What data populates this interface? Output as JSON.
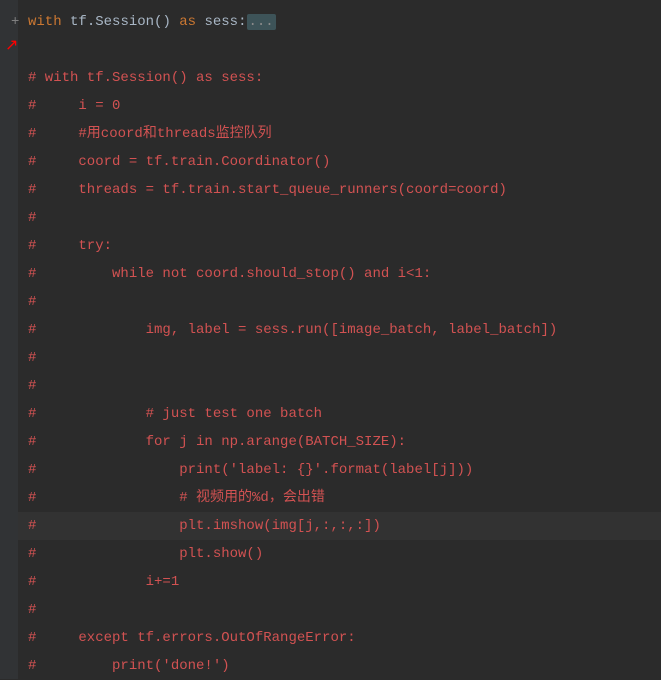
{
  "gutter": {
    "plus": "+"
  },
  "line1": {
    "with": "with",
    "tf": " tf",
    "dot": ".",
    "session": "Session",
    "paren": "()",
    "as": " as",
    "sess": " sess",
    "colon": ":",
    "folded": "..."
  },
  "arrow": "↗",
  "lines": {
    "l3": "# with tf.Session() as sess:",
    "l4": "#     i = 0",
    "l5": "#     #用coord和threads监控队列",
    "l6": "#     coord = tf.train.Coordinator()",
    "l7": "#     threads = tf.train.start_queue_runners(coord=coord)",
    "l8": "#",
    "l9": "#     try:",
    "l10": "#         while not coord.should_stop() and i<1:",
    "l11": "#",
    "l12": "#             img, label = sess.run([image_batch, label_batch])",
    "l13": "#",
    "l14": "#",
    "l15": "#             # just test one batch",
    "l16": "#             for j in np.arange(BATCH_SIZE):",
    "l17": "#                 print('label: {}'.format(label[j]))",
    "l18": "#                 # 视频用的%d，会出错",
    "l19": "#                 plt.imshow(img[j,:,:,:])",
    "l20": "#                 plt.show()",
    "l21": "#             i+=1",
    "l22": "#",
    "l23": "#     except tf.errors.OutOfRangeError:",
    "l24": "#         print('done!')"
  }
}
